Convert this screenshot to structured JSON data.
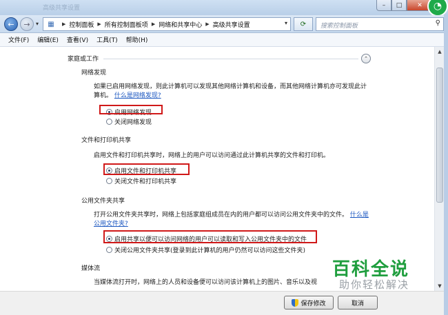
{
  "window": {
    "title": "高级共享设置",
    "badge": "◔"
  },
  "address": {
    "crumbs": [
      "控制面板",
      "所有控制面板项",
      "网络和共享中心",
      "高级共享设置"
    ],
    "search_placeholder": "搜索控制面板"
  },
  "menu": [
    "文件(F)",
    "编辑(E)",
    "查看(V)",
    "工具(T)",
    "帮助(H)"
  ],
  "profile": {
    "header": "家庭或工作"
  },
  "network_discovery": {
    "title": "网络发现",
    "desc": "如果已启用网络发现，则此计算机可以发现其他网络计算机和设备，而其他网络计算机亦可发现此计算机。",
    "link": "什么是网络发现?",
    "options": [
      "启用网络发现",
      "关闭网络发现"
    ]
  },
  "file_printer": {
    "title": "文件和打印机共享",
    "desc": "启用文件和打印机共享时，网络上的用户可以访问通过此计算机共享的文件和打印机。",
    "options": [
      "启用文件和打印机共享",
      "关闭文件和打印机共享"
    ]
  },
  "public_folder": {
    "title": "公用文件夹共享",
    "desc": "打开公用文件夹共享时，网络上包括家庭组成员在内的用户都可以访问公用文件夹中的文件。",
    "link": "什么是公用文件夹?",
    "options": [
      "启用共享以便可以访问网络的用户可以读取和写入公用文件夹中的文件",
      "关闭公用文件夹共享(登录到此计算机的用户仍然可以访问这些文件夹)"
    ]
  },
  "media": {
    "title": "媒体流",
    "desc": "当媒体流打开时，网络上的人员和设备便可以访问该计算机上的图片、音乐以及视"
  },
  "footer": {
    "save": "保存修改",
    "cancel": "取消"
  },
  "watermark": {
    "title": "百科全说",
    "subtitle": "助你轻松解决"
  }
}
